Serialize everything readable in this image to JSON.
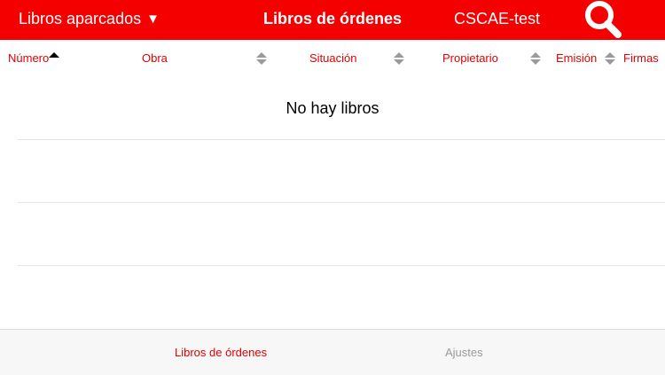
{
  "header": {
    "folder_label": "Libros aparcados",
    "dropdown_glyph": "▼",
    "title": "Libros de órdenes",
    "account": "CSCAE-test",
    "search_icon": "search-icon",
    "bar_color": "#f50000"
  },
  "columns": [
    {
      "label": "Número",
      "sort": "ascending"
    },
    {
      "label": "Obra",
      "sort": "none"
    },
    {
      "label": "Situación",
      "sort": "none"
    },
    {
      "label": "Propietario",
      "sort": "none"
    },
    {
      "label": "Emisión",
      "sort": "none"
    },
    {
      "label": "Firmas",
      "sort": "none"
    }
  ],
  "list": {
    "empty_message": "No hay libros"
  },
  "tabs": [
    {
      "label": "Libros de órdenes",
      "active": true
    },
    {
      "label": "Ajustes",
      "active": false
    }
  ],
  "colors": {
    "accent": "#e00000",
    "inactive_tab": "#9a9a9a"
  }
}
